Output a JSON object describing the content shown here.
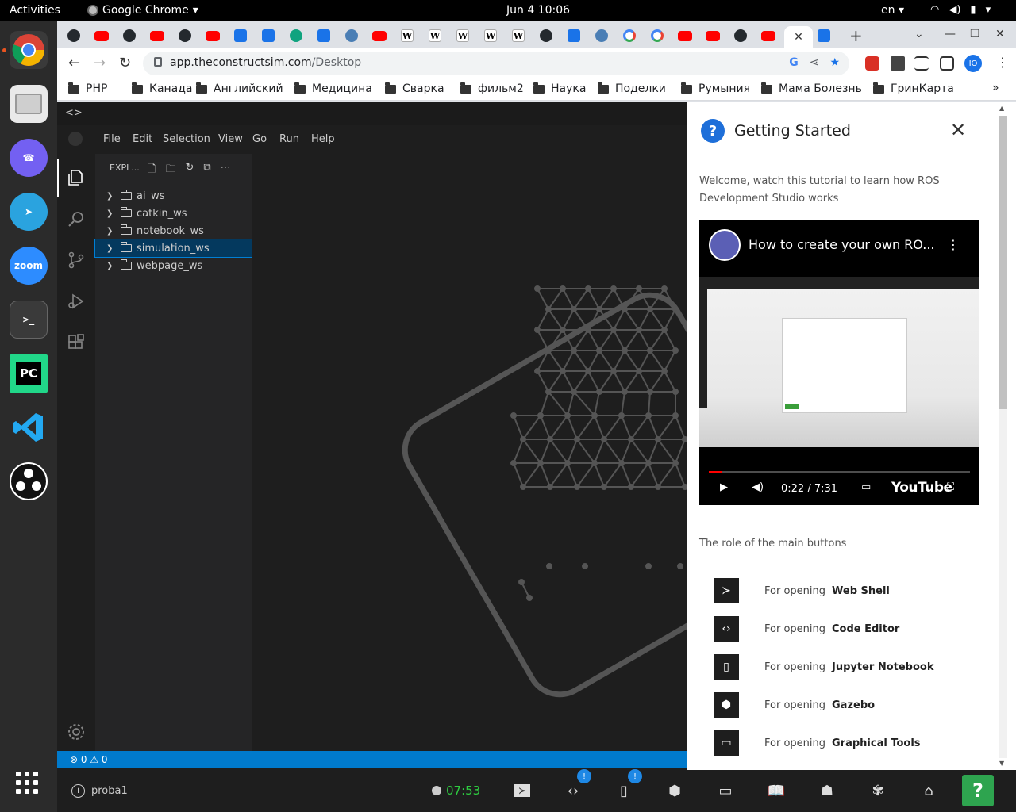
{
  "topbar": {
    "activities": "Activities",
    "app_name": "Google Chrome",
    "clock": "Jun 4  10:06",
    "lang": "en"
  },
  "dock": {
    "apps": [
      "chrome",
      "files",
      "viber",
      "telegram",
      "zoom",
      "terminal",
      "pycharm",
      "vscode",
      "obs"
    ],
    "zoom_label": "zoom",
    "terminal_label": ">_",
    "pycharm_label": "PC"
  },
  "browser": {
    "tabs": [
      "github",
      "youtube",
      "github",
      "youtube",
      "github",
      "youtube",
      "blue",
      "blue",
      "chatgpt",
      "blue",
      "eye",
      "youtube",
      "wiki",
      "wiki",
      "wiki",
      "wiki",
      "wiki",
      "github",
      "blue",
      "eye",
      "google",
      "google",
      "youtube",
      "youtube",
      "github",
      "youtube",
      "active",
      "blue"
    ],
    "wiki_glyph": "W",
    "url_host": "app.theconstructsim.com",
    "url_path": "/Desktop",
    "profile_initials": "Ю",
    "bookmarks": [
      "PHP",
      "Канада",
      "Английский",
      "Медицина",
      "Сварка",
      "фильм2",
      "Наука",
      "Поделки",
      "Румыния",
      "Мама Болезнь",
      "ГринКарта"
    ],
    "more": "»"
  },
  "codebar": {
    "icon": "<>"
  },
  "vscode": {
    "menu": [
      "File",
      "Edit",
      "Selection",
      "View",
      "Go",
      "Run",
      "Help"
    ],
    "explorer_title": "EXPL...",
    "folders": [
      "ai_ws",
      "catkin_ws",
      "notebook_ws",
      "simulation_ws",
      "webpage_ws"
    ],
    "selected_folder": "simulation_ws",
    "status": "⊗ 0 ⚠ 0"
  },
  "appbar": {
    "project": "proba1",
    "timer": "07:53",
    "badge_code": "!",
    "badge_notebook": "!",
    "help": "?"
  },
  "getting_started": {
    "title": "Getting Started",
    "welcome": "Welcome, watch this tutorial to learn how ROS Development Studio works",
    "video_title": "How to create your own RO...",
    "video_time": "0:22 / 7:31",
    "video_progress": 0.05,
    "video_brand": "YouTube",
    "role_heading": "The role of the main buttons",
    "buttons": [
      {
        "prefix": "For opening",
        "name": "Web Shell"
      },
      {
        "prefix": "For opening",
        "name": "Code Editor"
      },
      {
        "prefix": "For opening",
        "name": "Jupyter Notebook"
      },
      {
        "prefix": "For opening",
        "name": "Gazebo"
      },
      {
        "prefix": "For opening",
        "name": "Graphical Tools"
      }
    ]
  },
  "colors": {
    "accent_blue": "#007acc",
    "timer_green": "#2ecc40",
    "help_green": "#2ea44f"
  }
}
